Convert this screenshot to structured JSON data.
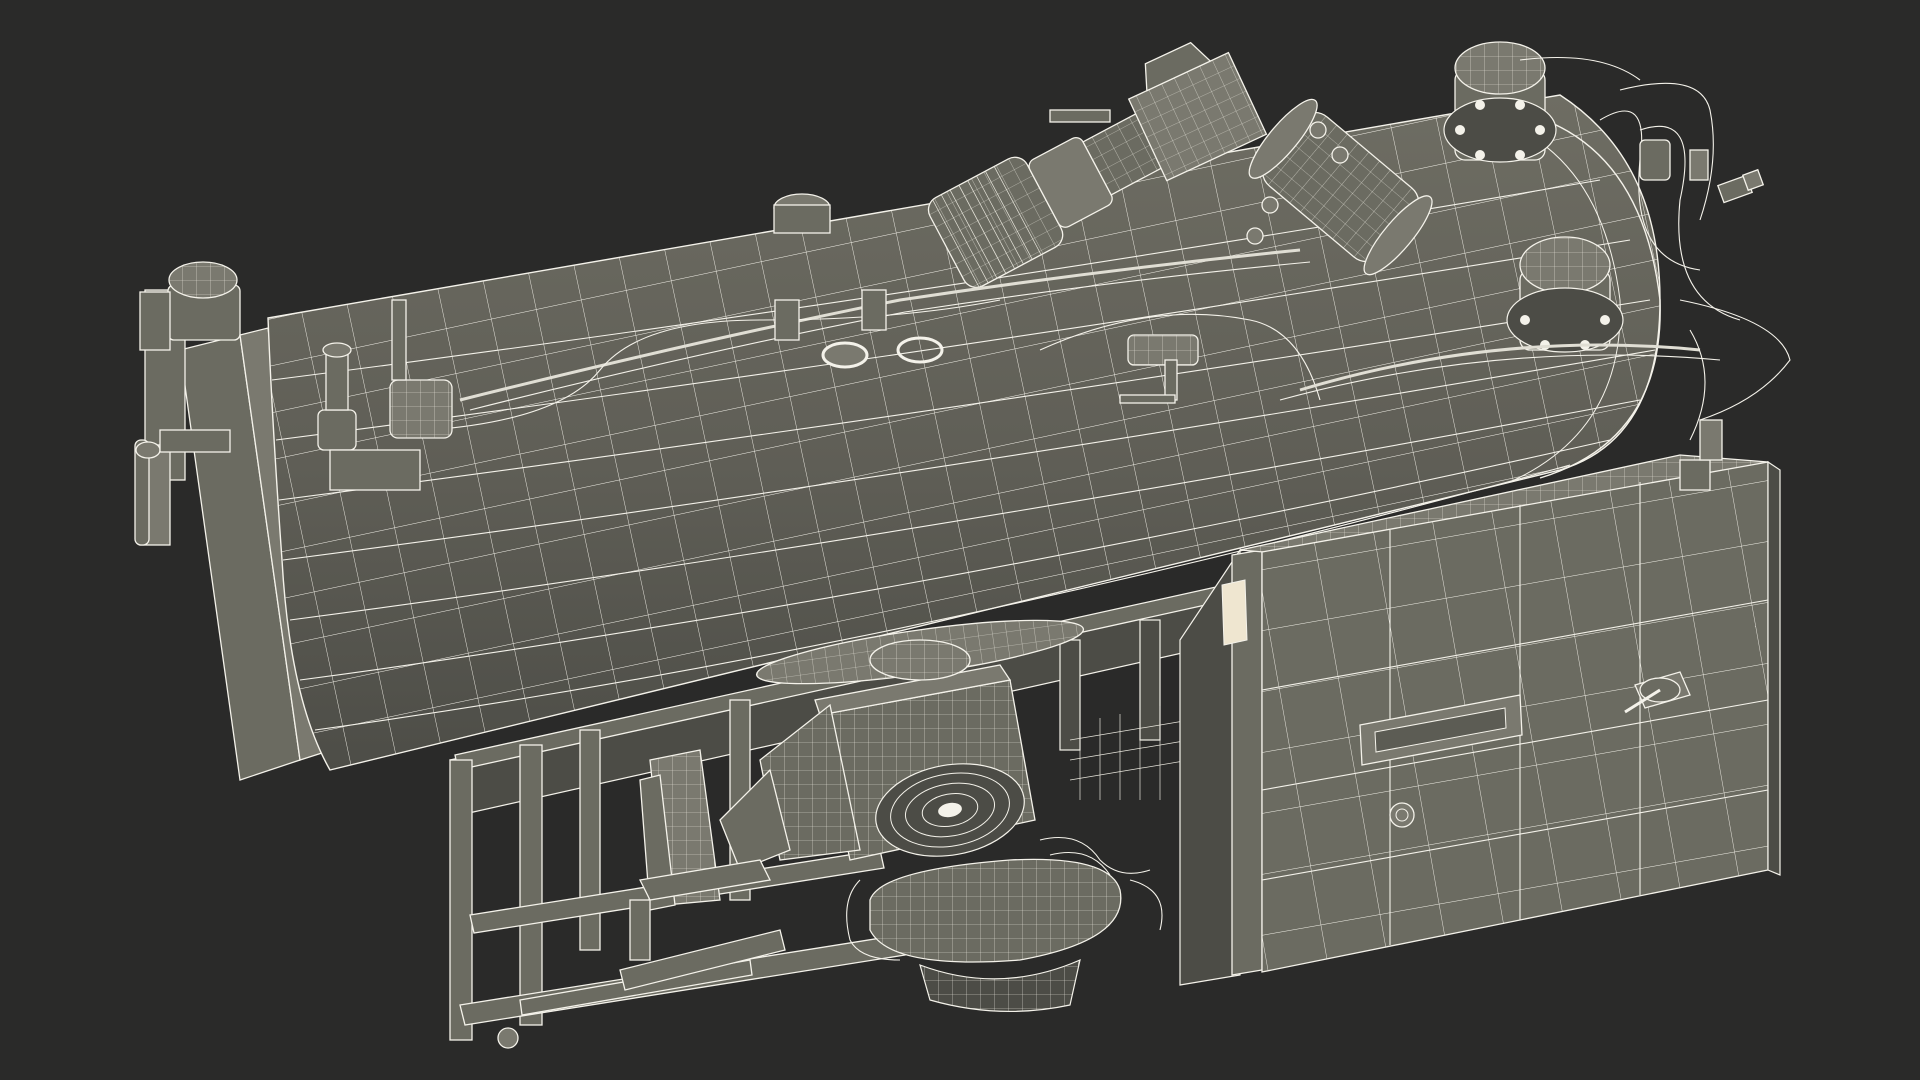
{
  "scene": {
    "subject": "",
    "background_color": "#2a2a29",
    "surface_color": "#6b6b61",
    "wire_color": "#f4f2ea"
  }
}
